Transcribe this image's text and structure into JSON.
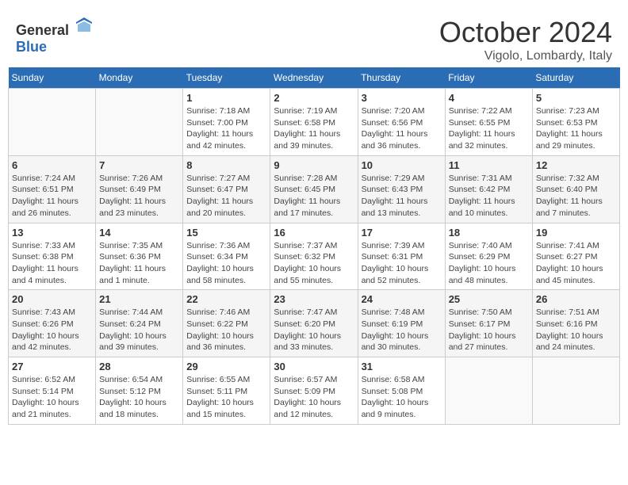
{
  "header": {
    "logo_general": "General",
    "logo_blue": "Blue",
    "month": "October 2024",
    "location": "Vigolo, Lombardy, Italy"
  },
  "days_of_week": [
    "Sunday",
    "Monday",
    "Tuesday",
    "Wednesday",
    "Thursday",
    "Friday",
    "Saturday"
  ],
  "weeks": [
    [
      {
        "day": "",
        "info": ""
      },
      {
        "day": "",
        "info": ""
      },
      {
        "day": "1",
        "info": "Sunrise: 7:18 AM\nSunset: 7:00 PM\nDaylight: 11 hours and 42 minutes."
      },
      {
        "day": "2",
        "info": "Sunrise: 7:19 AM\nSunset: 6:58 PM\nDaylight: 11 hours and 39 minutes."
      },
      {
        "day": "3",
        "info": "Sunrise: 7:20 AM\nSunset: 6:56 PM\nDaylight: 11 hours and 36 minutes."
      },
      {
        "day": "4",
        "info": "Sunrise: 7:22 AM\nSunset: 6:55 PM\nDaylight: 11 hours and 32 minutes."
      },
      {
        "day": "5",
        "info": "Sunrise: 7:23 AM\nSunset: 6:53 PM\nDaylight: 11 hours and 29 minutes."
      }
    ],
    [
      {
        "day": "6",
        "info": "Sunrise: 7:24 AM\nSunset: 6:51 PM\nDaylight: 11 hours and 26 minutes."
      },
      {
        "day": "7",
        "info": "Sunrise: 7:26 AM\nSunset: 6:49 PM\nDaylight: 11 hours and 23 minutes."
      },
      {
        "day": "8",
        "info": "Sunrise: 7:27 AM\nSunset: 6:47 PM\nDaylight: 11 hours and 20 minutes."
      },
      {
        "day": "9",
        "info": "Sunrise: 7:28 AM\nSunset: 6:45 PM\nDaylight: 11 hours and 17 minutes."
      },
      {
        "day": "10",
        "info": "Sunrise: 7:29 AM\nSunset: 6:43 PM\nDaylight: 11 hours and 13 minutes."
      },
      {
        "day": "11",
        "info": "Sunrise: 7:31 AM\nSunset: 6:42 PM\nDaylight: 11 hours and 10 minutes."
      },
      {
        "day": "12",
        "info": "Sunrise: 7:32 AM\nSunset: 6:40 PM\nDaylight: 11 hours and 7 minutes."
      }
    ],
    [
      {
        "day": "13",
        "info": "Sunrise: 7:33 AM\nSunset: 6:38 PM\nDaylight: 11 hours and 4 minutes."
      },
      {
        "day": "14",
        "info": "Sunrise: 7:35 AM\nSunset: 6:36 PM\nDaylight: 11 hours and 1 minute."
      },
      {
        "day": "15",
        "info": "Sunrise: 7:36 AM\nSunset: 6:34 PM\nDaylight: 10 hours and 58 minutes."
      },
      {
        "day": "16",
        "info": "Sunrise: 7:37 AM\nSunset: 6:32 PM\nDaylight: 10 hours and 55 minutes."
      },
      {
        "day": "17",
        "info": "Sunrise: 7:39 AM\nSunset: 6:31 PM\nDaylight: 10 hours and 52 minutes."
      },
      {
        "day": "18",
        "info": "Sunrise: 7:40 AM\nSunset: 6:29 PM\nDaylight: 10 hours and 48 minutes."
      },
      {
        "day": "19",
        "info": "Sunrise: 7:41 AM\nSunset: 6:27 PM\nDaylight: 10 hours and 45 minutes."
      }
    ],
    [
      {
        "day": "20",
        "info": "Sunrise: 7:43 AM\nSunset: 6:26 PM\nDaylight: 10 hours and 42 minutes."
      },
      {
        "day": "21",
        "info": "Sunrise: 7:44 AM\nSunset: 6:24 PM\nDaylight: 10 hours and 39 minutes."
      },
      {
        "day": "22",
        "info": "Sunrise: 7:46 AM\nSunset: 6:22 PM\nDaylight: 10 hours and 36 minutes."
      },
      {
        "day": "23",
        "info": "Sunrise: 7:47 AM\nSunset: 6:20 PM\nDaylight: 10 hours and 33 minutes."
      },
      {
        "day": "24",
        "info": "Sunrise: 7:48 AM\nSunset: 6:19 PM\nDaylight: 10 hours and 30 minutes."
      },
      {
        "day": "25",
        "info": "Sunrise: 7:50 AM\nSunset: 6:17 PM\nDaylight: 10 hours and 27 minutes."
      },
      {
        "day": "26",
        "info": "Sunrise: 7:51 AM\nSunset: 6:16 PM\nDaylight: 10 hours and 24 minutes."
      }
    ],
    [
      {
        "day": "27",
        "info": "Sunrise: 6:52 AM\nSunset: 5:14 PM\nDaylight: 10 hours and 21 minutes."
      },
      {
        "day": "28",
        "info": "Sunrise: 6:54 AM\nSunset: 5:12 PM\nDaylight: 10 hours and 18 minutes."
      },
      {
        "day": "29",
        "info": "Sunrise: 6:55 AM\nSunset: 5:11 PM\nDaylight: 10 hours and 15 minutes."
      },
      {
        "day": "30",
        "info": "Sunrise: 6:57 AM\nSunset: 5:09 PM\nDaylight: 10 hours and 12 minutes."
      },
      {
        "day": "31",
        "info": "Sunrise: 6:58 AM\nSunset: 5:08 PM\nDaylight: 10 hours and 9 minutes."
      },
      {
        "day": "",
        "info": ""
      },
      {
        "day": "",
        "info": ""
      }
    ]
  ]
}
